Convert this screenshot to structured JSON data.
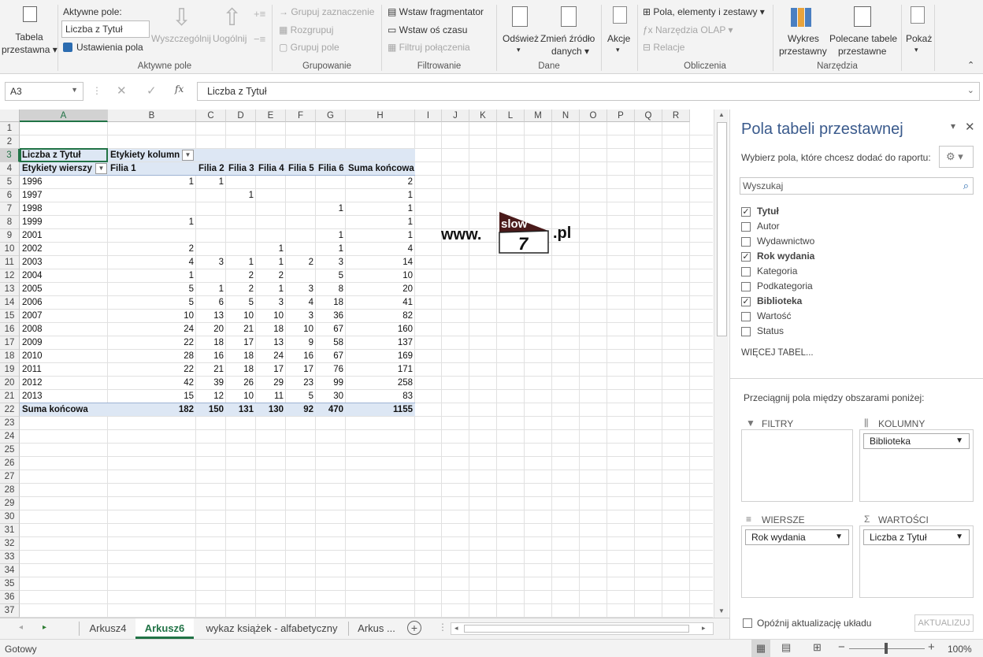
{
  "ribbon": {
    "pivot_table": [
      "Tabela",
      "przestawna ▾"
    ],
    "active_field_label": "Aktywne pole:",
    "active_field_value": "Liczba z Tytuł",
    "field_settings": "Ustawienia pola",
    "drill_down": "Wyszczególnij",
    "drill_up": "Uogólnij",
    "group_active_field": "Aktywne pole",
    "group_selection": "Grupuj zaznaczenie",
    "ungroup": "Rozgrupuj",
    "group_field": "Grupuj pole",
    "group_group": "Grupowanie",
    "insert_slicer": "Wstaw fragmentator",
    "insert_timeline": "Wstaw oś czasu",
    "filter_connections": "Filtruj połączenia",
    "group_filter": "Filtrowanie",
    "refresh": "Odśwież",
    "change_source": [
      "Zmień źródło",
      "danych ▾"
    ],
    "group_data": "Dane",
    "actions": "Akcje",
    "fields_items_sets": "Pola, elementy i zestawy ▾",
    "olap_tools": "Narzędzia OLAP ▾",
    "relationships": "Relacje",
    "group_calculations": "Obliczenia",
    "pivot_chart": [
      "Wykres",
      "przestawny"
    ],
    "recommended": [
      "Polecane tabele",
      "przestawne"
    ],
    "group_tools": "Narzędzia",
    "show": "Pokaż"
  },
  "formula_bar": {
    "name_box": "A3",
    "fx": "fx",
    "formula": "Liczba z Tytuł"
  },
  "columns": [
    "A",
    "B",
    "C",
    "D",
    "E",
    "F",
    "G",
    "H",
    "I",
    "J",
    "K",
    "L",
    "M",
    "N",
    "O",
    "P",
    "Q",
    "R"
  ],
  "rows": [
    1,
    2,
    3,
    4,
    5,
    6,
    7,
    8,
    9,
    10,
    11,
    12,
    13,
    14,
    15,
    16,
    17,
    18,
    19,
    20,
    21,
    22,
    23,
    24,
    25,
    26,
    27,
    28,
    29,
    30,
    31,
    32,
    33,
    34,
    35,
    36,
    37
  ],
  "pivot": {
    "value_label": "Liczba z Tytuł",
    "col_labels": "Etykiety kolumn",
    "row_labels": "Etykiety wierszy",
    "headers": [
      "Filia 1",
      "Filia 2",
      "Filia 3",
      "Filia 4",
      "Filia 5",
      "Filia 6",
      "Suma końcowa"
    ],
    "data": [
      [
        "1996",
        "1",
        "1",
        "",
        "",
        "",
        "",
        "2"
      ],
      [
        "1997",
        "",
        "",
        "1",
        "",
        "",
        "",
        "1"
      ],
      [
        "1998",
        "",
        "",
        "",
        "",
        "",
        "1",
        "1"
      ],
      [
        "1999",
        "1",
        "",
        "",
        "",
        "",
        "",
        "1"
      ],
      [
        "2001",
        "",
        "",
        "",
        "",
        "",
        "1",
        "1"
      ],
      [
        "2002",
        "2",
        "",
        "",
        "1",
        "",
        "1",
        "4"
      ],
      [
        "2003",
        "4",
        "3",
        "1",
        "1",
        "2",
        "3",
        "14"
      ],
      [
        "2004",
        "1",
        "",
        "2",
        "2",
        "",
        "5",
        "10"
      ],
      [
        "2005",
        "5",
        "1",
        "2",
        "1",
        "3",
        "8",
        "20"
      ],
      [
        "2006",
        "5",
        "6",
        "5",
        "3",
        "4",
        "18",
        "41"
      ],
      [
        "2007",
        "10",
        "13",
        "10",
        "10",
        "3",
        "36",
        "82"
      ],
      [
        "2008",
        "24",
        "20",
        "21",
        "18",
        "10",
        "67",
        "160"
      ],
      [
        "2009",
        "22",
        "18",
        "17",
        "13",
        "9",
        "58",
        "137"
      ],
      [
        "2010",
        "28",
        "16",
        "18",
        "24",
        "16",
        "67",
        "169"
      ],
      [
        "2011",
        "22",
        "21",
        "18",
        "17",
        "17",
        "76",
        "171"
      ],
      [
        "2012",
        "42",
        "39",
        "26",
        "29",
        "23",
        "99",
        "258"
      ],
      [
        "2013",
        "15",
        "12",
        "10",
        "11",
        "5",
        "30",
        "83"
      ]
    ],
    "total": [
      "Suma końcowa",
      "182",
      "150",
      "131",
      "130",
      "92",
      "470",
      "1155"
    ]
  },
  "logo": {
    "www": "www.",
    "slow": "slow",
    "seven": "7",
    "pl": ".pl"
  },
  "pane": {
    "title": "Pola tabeli przestawnej",
    "subtitle": "Wybierz pola, które chcesz dodać do raportu:",
    "search_placeholder": "Wyszukaj",
    "fields": [
      {
        "label": "Tytuł",
        "checked": true
      },
      {
        "label": "Autor",
        "checked": false
      },
      {
        "label": "Wydawnictwo",
        "checked": false
      },
      {
        "label": "Rok wydania",
        "checked": true
      },
      {
        "label": "Kategoria",
        "checked": false
      },
      {
        "label": "Podkategoria",
        "checked": false
      },
      {
        "label": "Biblioteka",
        "checked": true
      },
      {
        "label": "Wartość",
        "checked": false
      },
      {
        "label": "Status",
        "checked": false
      }
    ],
    "more_tables": "WIĘCEJ TABEL...",
    "drag_hint": "Przeciągnij pola między obszarami poniżej:",
    "filters": "FILTRY",
    "columns": "KOLUMNY",
    "rows": "WIERSZE",
    "values": "WARTOŚCI",
    "columns_item": "Biblioteka",
    "rows_item": "Rok wydania",
    "values_item": "Liczba z Tytuł",
    "defer": "Opóźnij aktualizację układu",
    "update": "AKTUALIZUJ"
  },
  "tabs": [
    "Arkusz4",
    "Arkusz6",
    "wykaz książek - alfabetyczny",
    "Arkus ..."
  ],
  "status": {
    "ready": "Gotowy",
    "zoom": "100%"
  }
}
